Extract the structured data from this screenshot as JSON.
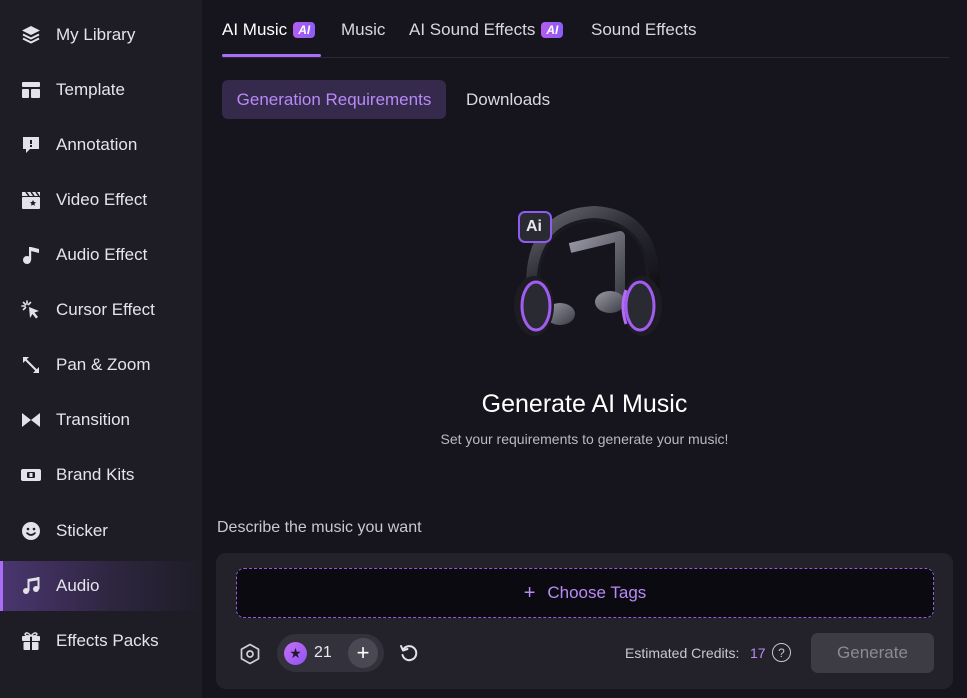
{
  "sidebar": {
    "items": [
      {
        "label": "My Library",
        "icon": "stack-layers-icon"
      },
      {
        "label": "Template",
        "icon": "template-layout-icon"
      },
      {
        "label": "Annotation",
        "icon": "speech-bubble-icon"
      },
      {
        "label": "Video Effect",
        "icon": "clapperboard-icon"
      },
      {
        "label": "Audio Effect",
        "icon": "music-note-icon"
      },
      {
        "label": "Cursor Effect",
        "icon": "cursor-click-icon"
      },
      {
        "label": "Pan & Zoom",
        "icon": "expand-arrows-icon"
      },
      {
        "label": "Transition",
        "icon": "bowtie-transition-icon"
      },
      {
        "label": "Brand Kits",
        "icon": "brand-kit-icon"
      },
      {
        "label": "Sticker",
        "icon": "smiley-icon"
      },
      {
        "label": "Audio",
        "icon": "double-note-icon"
      },
      {
        "label": "Effects Packs",
        "icon": "gift-box-icon"
      }
    ],
    "active_index": 10
  },
  "tabs": {
    "ai_music": "AI Music",
    "music": "Music",
    "ai_sound_effects": "AI Sound Effects",
    "sound_effects": "Sound Effects",
    "ai_badge": "AI"
  },
  "subtabs": {
    "generation_requirements": "Generation Requirements",
    "downloads": "Downloads"
  },
  "hero": {
    "badge": "Ai",
    "title": "Generate AI Music",
    "subtitle": "Set your requirements to generate your music!"
  },
  "describe": {
    "label": "Describe the music you want",
    "choose_tags": "Choose Tags",
    "credits_count": "21",
    "estimated_label": "Estimated Credits:",
    "estimated_value": "17",
    "help": "?",
    "generate": "Generate"
  },
  "colors": {
    "accent": "#a86cf5",
    "sidebar_bg": "#1e1d26",
    "main_bg": "#16151d"
  }
}
